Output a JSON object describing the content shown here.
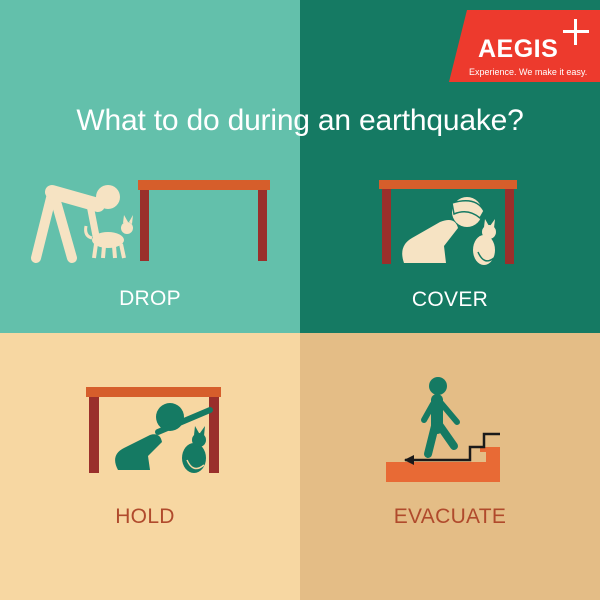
{
  "title": "What to do during an earthquake?",
  "logo": {
    "name": "AEGIS",
    "tagline": "Experience. We make it easy.",
    "color": "#ed3a2d"
  },
  "steps": [
    {
      "label": "DROP",
      "bg": "#63c0ab"
    },
    {
      "label": "COVER",
      "bg": "#157a63"
    },
    {
      "label": "HOLD",
      "bg": "#f7d7a2"
    },
    {
      "label": "EVACUATE",
      "bg": "#e4bd86"
    }
  ],
  "colors": {
    "figure_cream": "#f6e3c3",
    "figure_green": "#157a63",
    "table_top": "#d65e2b",
    "table_leg": "#9a2f2b",
    "stairs": "#e86a35",
    "label_dark": "#b04a2c"
  }
}
